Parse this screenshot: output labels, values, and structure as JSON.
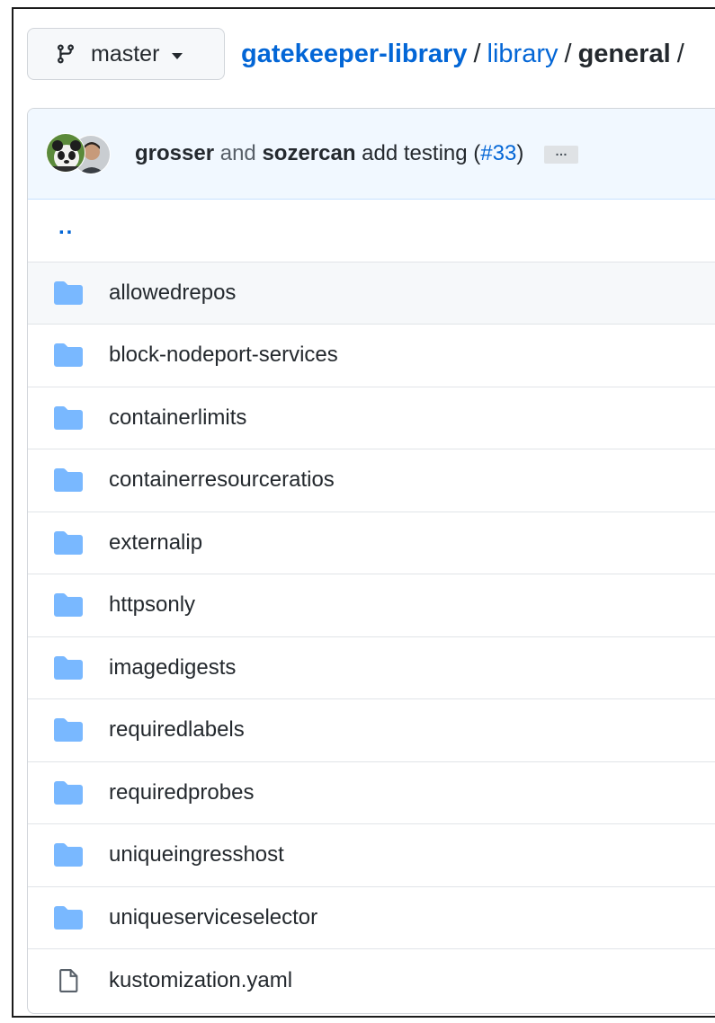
{
  "branch": {
    "label": "master",
    "icon": "git-branch-icon"
  },
  "breadcrumb": {
    "repo": "gatekeeper-library",
    "path1": "library",
    "current": "general",
    "separator": "/"
  },
  "commit": {
    "author1": "grosser",
    "connector": "and",
    "author2": "sozercan",
    "message": "add testing",
    "pr_open": "(",
    "pr": "#33",
    "pr_close": ")",
    "ellipsis": "…"
  },
  "parent_dir": "..",
  "files": [
    {
      "name": "allowedrepos",
      "type": "dir"
    },
    {
      "name": "block-nodeport-services",
      "type": "dir"
    },
    {
      "name": "containerlimits",
      "type": "dir"
    },
    {
      "name": "containerresourceratios",
      "type": "dir"
    },
    {
      "name": "externalip",
      "type": "dir"
    },
    {
      "name": "httpsonly",
      "type": "dir"
    },
    {
      "name": "imagedigests",
      "type": "dir"
    },
    {
      "name": "requiredlabels",
      "type": "dir"
    },
    {
      "name": "requiredprobes",
      "type": "dir"
    },
    {
      "name": "uniqueingresshost",
      "type": "dir"
    },
    {
      "name": "uniqueserviceselector",
      "type": "dir"
    },
    {
      "name": "kustomization.yaml",
      "type": "file"
    }
  ],
  "colors": {
    "link": "#0366d6",
    "folder": "#79b8ff",
    "header_bg": "#f1f8ff",
    "border": "#e1e4e8"
  }
}
